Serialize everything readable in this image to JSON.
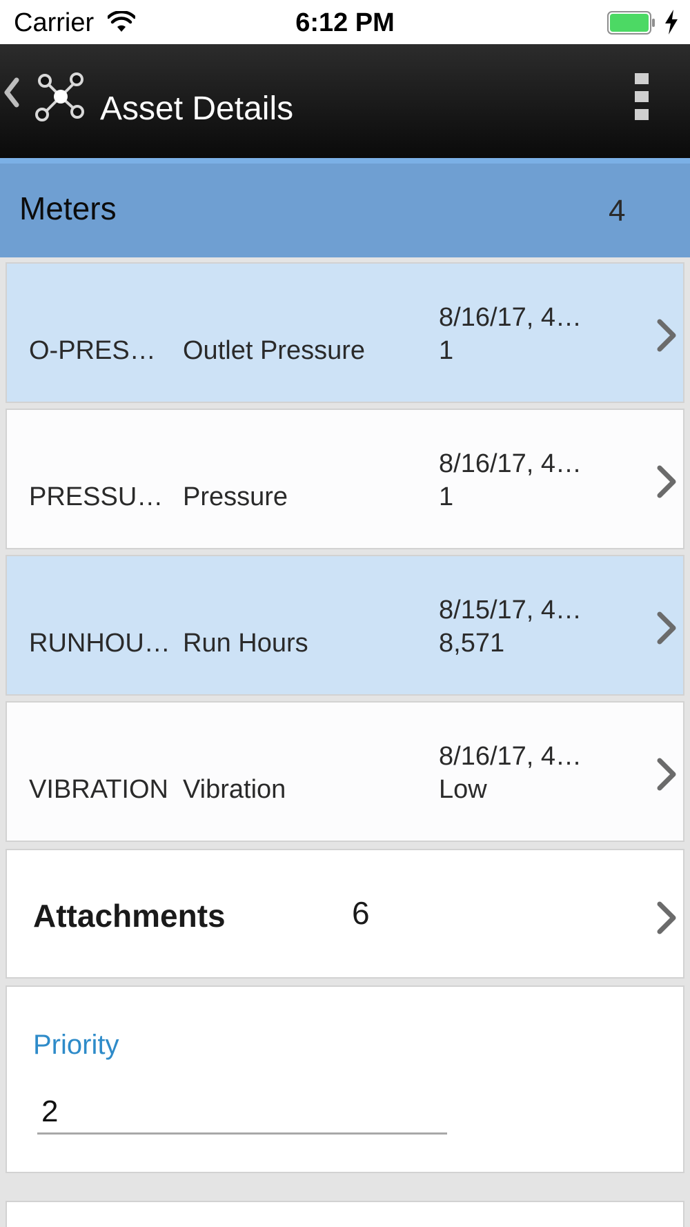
{
  "status_bar": {
    "carrier": "Carrier",
    "time": "6:12 PM",
    "battery_color": "#4cd964"
  },
  "nav": {
    "title": "Asset Details",
    "back_icon": "chevron-left-icon",
    "app_icon": "network-nodes-icon",
    "menu_icon": "overflow-menu-icon"
  },
  "meters": {
    "title": "Meters",
    "count": "4",
    "rows": [
      {
        "code": "O-PRES…",
        "name": "Outlet Pressure",
        "date": "8/16/17, 4…",
        "value": "1"
      },
      {
        "code": "PRESSU…",
        "name": "Pressure",
        "date": "8/16/17, 4…",
        "value": "1"
      },
      {
        "code": "RUNHOU…",
        "name": "Run Hours",
        "date": "8/15/17, 4…",
        "value": "8,571"
      },
      {
        "code": "VIBRATION",
        "name": "Vibration",
        "date": "8/16/17, 4…",
        "value": "Low"
      }
    ]
  },
  "attachments": {
    "label": "Attachments",
    "count": "6"
  },
  "priority": {
    "label": "Priority",
    "value": "2"
  },
  "colors": {
    "header_blue": "#6f9fd2",
    "row_alt": "#cde2f6",
    "accent_line": "#7bb0e6",
    "priority_label": "#2e8bc9"
  }
}
